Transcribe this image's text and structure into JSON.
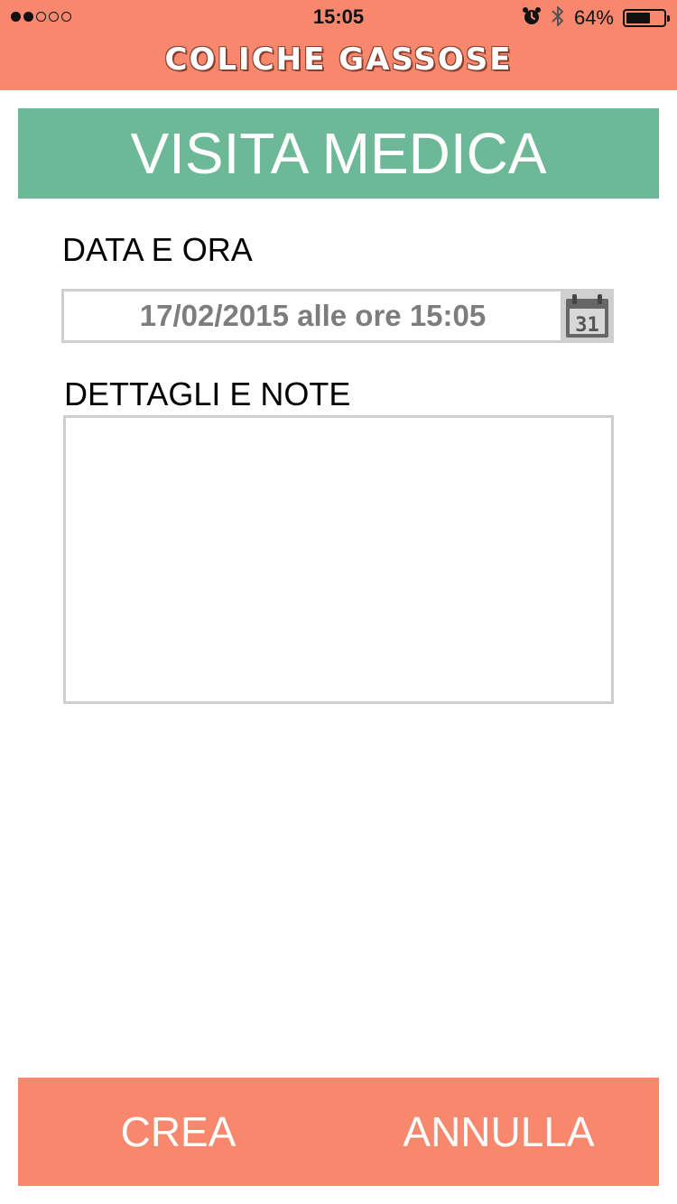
{
  "status_bar": {
    "signal_bars_filled": 2,
    "signal_bars_total": 5,
    "time": "15:05",
    "alarm_icon": "alarm-clock-icon",
    "bluetooth_icon": "bluetooth-icon",
    "battery_percent_text": "64%",
    "battery_level": 0.64
  },
  "app": {
    "title": "COLICHE GASSOSE"
  },
  "section": {
    "title": "VISITA MEDICA"
  },
  "form": {
    "date_label": "DATA E ORA",
    "date_value": "17/02/2015 alle ore 15:05",
    "calendar_icon": "calendar-icon",
    "calendar_day": "31",
    "notes_label": "DETTAGLI E NOTE",
    "notes_value": ""
  },
  "actions": {
    "create_label": "CREA",
    "cancel_label": "ANNULLA"
  },
  "colors": {
    "header": "#f7876d",
    "banner": "#6db897",
    "field_border": "#cfcfcf",
    "date_text": "#7d7d7d"
  }
}
